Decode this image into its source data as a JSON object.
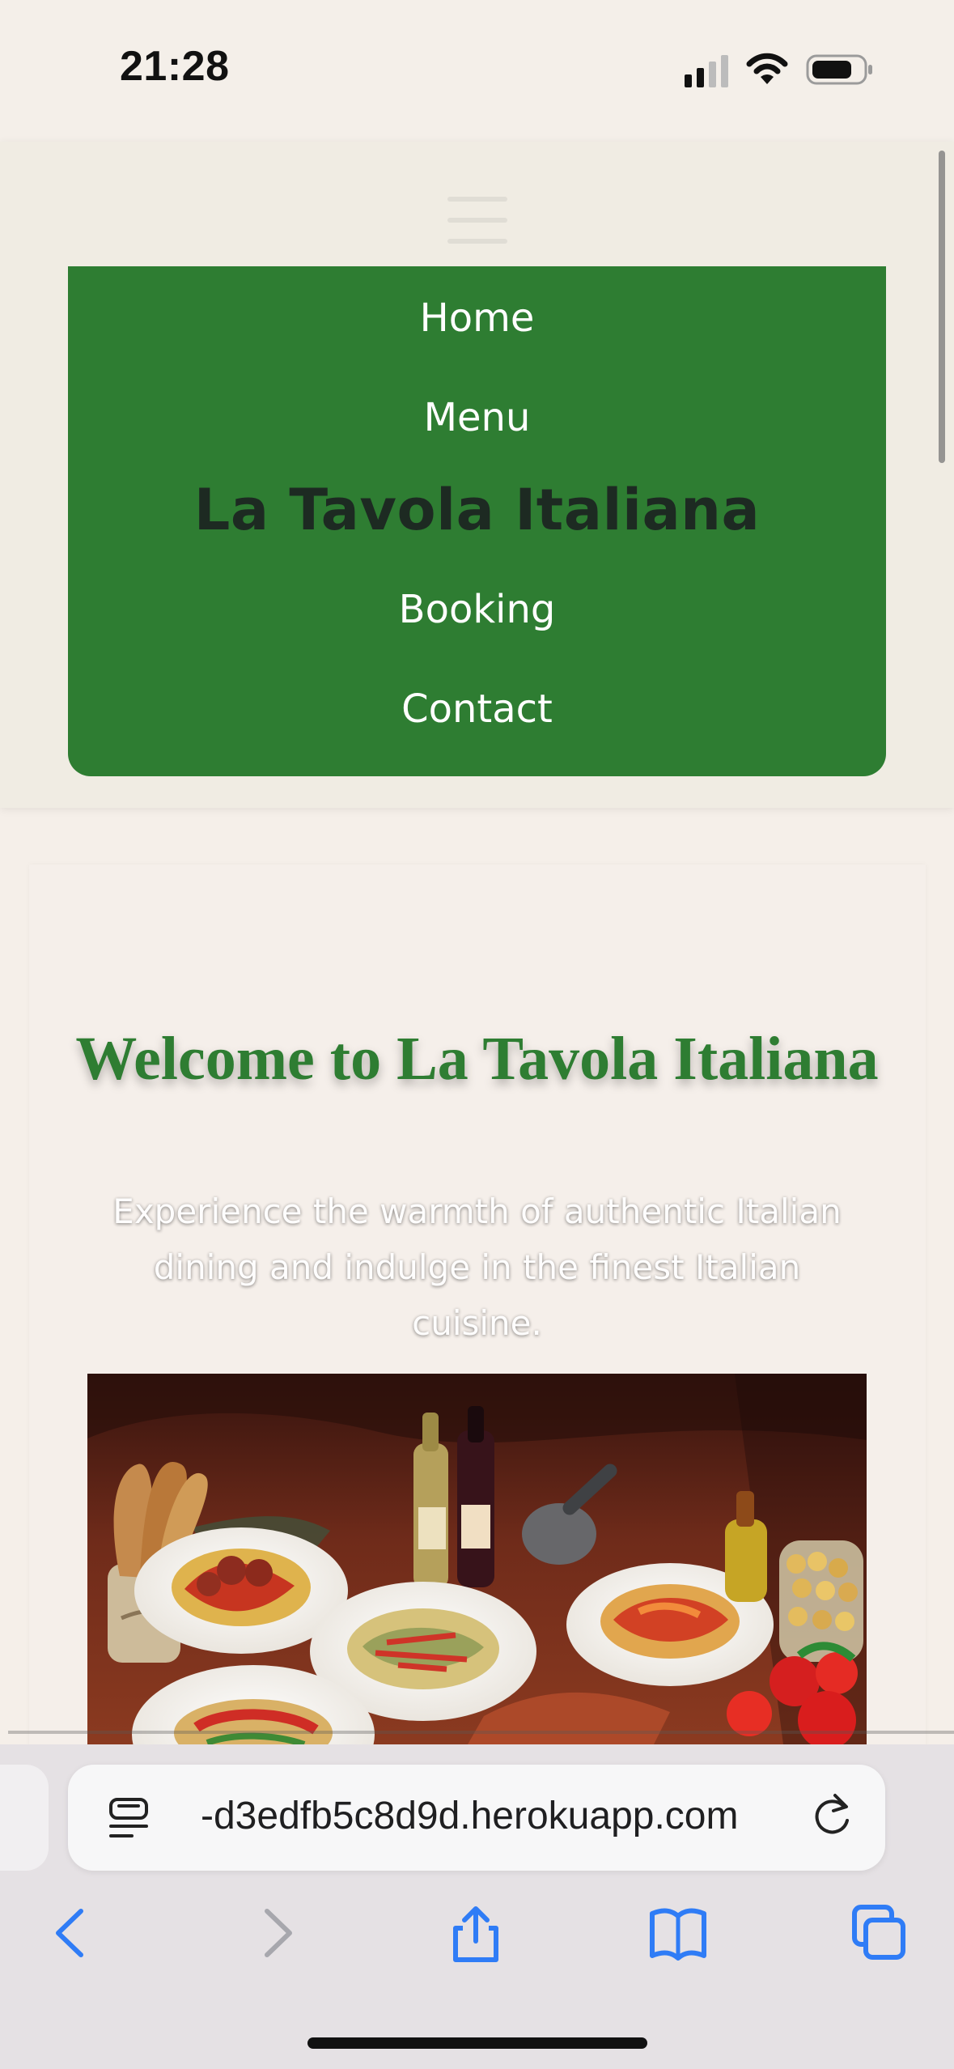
{
  "status_bar": {
    "time": "21:28",
    "icons": [
      "cellular-signal-icon",
      "wifi-icon",
      "battery-icon"
    ]
  },
  "header": {
    "menu_icon": "hamburger-menu-icon",
    "nav_items": [
      "Home",
      "Menu",
      "Booking",
      "Contact"
    ],
    "brand": "La Tavola Italiana"
  },
  "hero": {
    "title": "Welcome to La Tavola Italiana",
    "subtitle": "Experience the warmth of authentic Italian dining and indulge in the finest Italian cuisine.",
    "image_icon": "italian-food-photo"
  },
  "browser": {
    "url": "-d3edfb5c8d9d.herokuapp.com",
    "reader_icon": "reader-view-icon",
    "reload_icon": "reload-icon",
    "toolbar_icons": [
      "back-icon",
      "forward-icon",
      "share-icon",
      "bookmarks-icon",
      "tabs-icon"
    ]
  },
  "colors": {
    "nav_green": "#2e7d32",
    "brand_dark": "#1d2a22",
    "page_background": "#f5efe9",
    "safari_blue": "#2f7cf6"
  }
}
